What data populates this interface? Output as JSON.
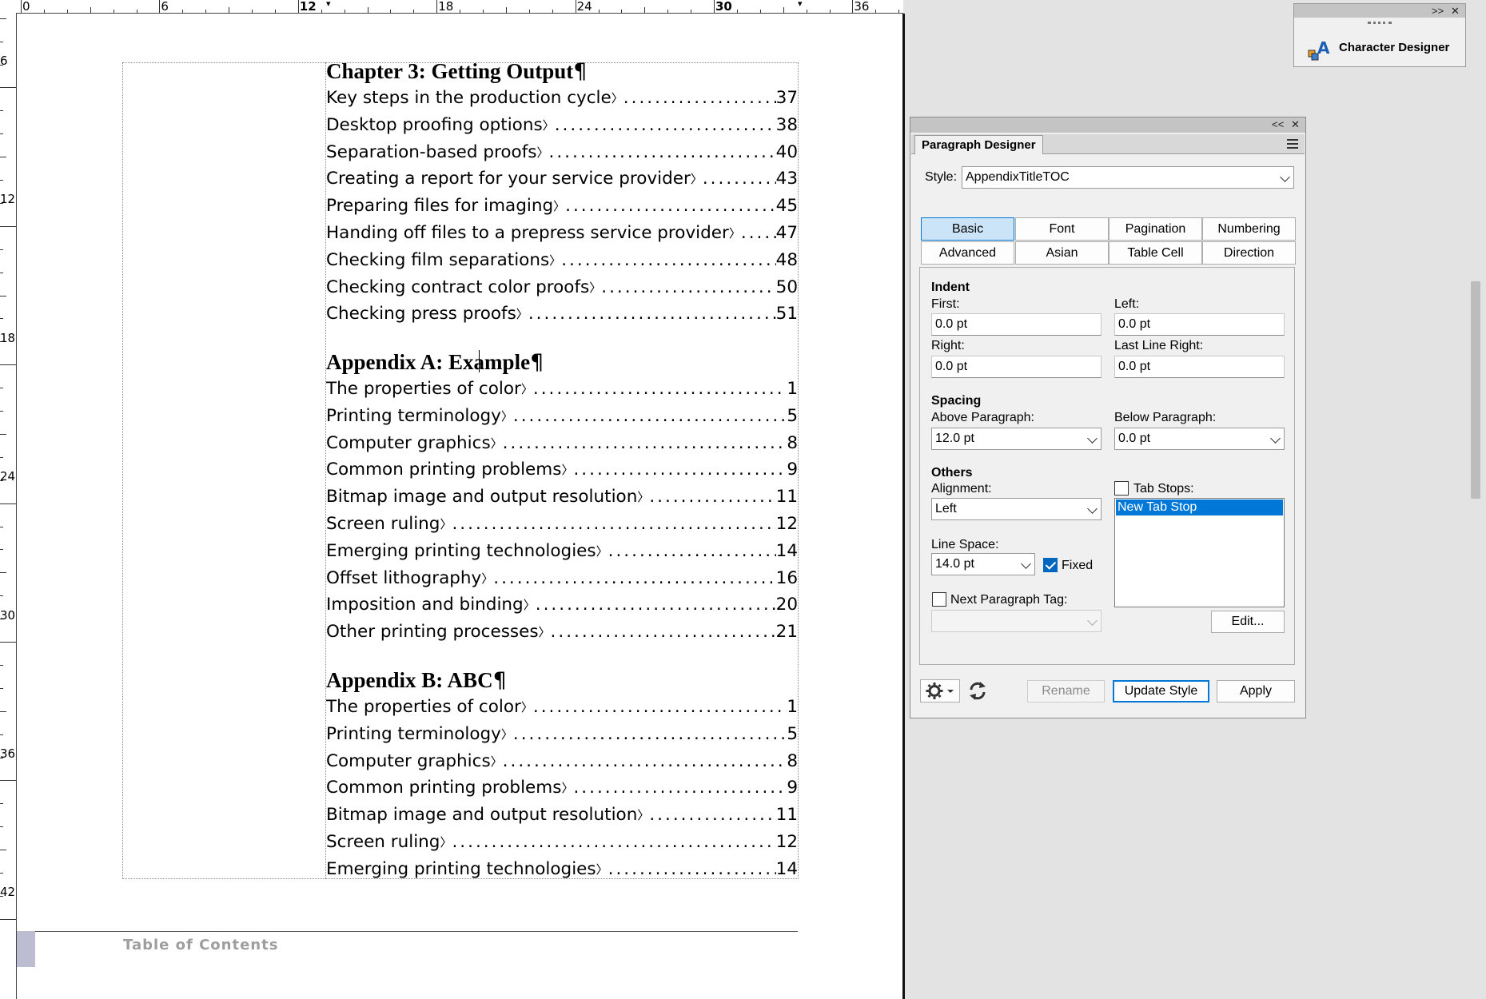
{
  "ruler": {
    "horizontal_labels": [
      "0",
      "6",
      "12",
      "18",
      "24",
      "30",
      "36"
    ],
    "vertical_labels": [
      "6",
      "12",
      "18",
      "24",
      "30",
      "36",
      "42"
    ]
  },
  "document": {
    "sections": [
      {
        "heading": "Chapter 3: Getting Output",
        "entries": [
          {
            "text": "Key steps in the production cycle",
            "page": "37"
          },
          {
            "text": "Desktop proofing options",
            "page": "38"
          },
          {
            "text": "Separation-based proofs",
            "page": "40"
          },
          {
            "text": "Creating a report for your service provider",
            "page": "43"
          },
          {
            "text": "Preparing files for imaging",
            "page": "45"
          },
          {
            "text": "Handing off files to a prepress service provider",
            "page": "47"
          },
          {
            "text": "Checking film separations",
            "page": "48"
          },
          {
            "text": "Checking contract color proofs",
            "page": "50"
          },
          {
            "text": "Checking press proofs",
            "page": "51"
          }
        ]
      },
      {
        "heading": "Appendix A: Example",
        "entries": [
          {
            "text": "The properties of color",
            "page": "1"
          },
          {
            "text": "Printing terminology",
            "page": "5"
          },
          {
            "text": "Computer graphics",
            "page": "8"
          },
          {
            "text": "Common printing problems",
            "page": "9"
          },
          {
            "text": "Bitmap image and output resolution",
            "page": "11"
          },
          {
            "text": "Screen ruling",
            "page": "12"
          },
          {
            "text": "Emerging printing technologies",
            "page": "14"
          },
          {
            "text": "Offset lithography",
            "page": "16"
          },
          {
            "text": "Imposition and binding",
            "page": "20"
          },
          {
            "text": "Other printing processes",
            "page": "21"
          }
        ]
      },
      {
        "heading": "Appendix B: ABC",
        "entries": [
          {
            "text": "The properties of color",
            "page": "1"
          },
          {
            "text": "Printing terminology",
            "page": "5"
          },
          {
            "text": "Computer graphics",
            "page": "8"
          },
          {
            "text": "Common printing problems",
            "page": "9"
          },
          {
            "text": "Bitmap image and output resolution",
            "page": "11"
          },
          {
            "text": "Screen ruling",
            "page": "12"
          },
          {
            "text": "Emerging printing technologies",
            "page": "14"
          }
        ]
      }
    ],
    "pilcrow": "¶",
    "entry_end_mark": "〉",
    "footer": "Table of Contents"
  },
  "character_designer": {
    "title": "Character Designer",
    "controls": ">>",
    "close": "✕"
  },
  "paragraph_designer": {
    "title": "Paragraph Designer",
    "controls": "<<",
    "close": "✕",
    "style_label": "Style:",
    "style_value": "AppendixTitleTOC",
    "tabs": [
      "Basic",
      "Font",
      "Pagination",
      "Numbering",
      "Advanced",
      "Asian",
      "Table Cell",
      "Direction"
    ],
    "active_tab": "Basic",
    "indent": {
      "heading": "Indent",
      "first_label": "First:",
      "first_value": "0.0 pt",
      "left_label": "Left:",
      "left_value": "0.0 pt",
      "right_label": "Right:",
      "right_value": "0.0 pt",
      "last_line_right_label": "Last Line Right:",
      "last_line_right_value": "0.0 pt"
    },
    "spacing": {
      "heading": "Spacing",
      "above_label": "Above Paragraph:",
      "above_value": "12.0 pt",
      "below_label": "Below Paragraph:",
      "below_value": "0.0 pt"
    },
    "others": {
      "heading": "Others",
      "alignment_label": "Alignment:",
      "alignment_value": "Left",
      "tab_stops_label": "Tab Stops:",
      "tab_stops_checked": false,
      "tab_stop_item": "New Tab Stop",
      "line_space_label": "Line Space:",
      "line_space_value": "14.0 pt",
      "fixed_label": "Fixed",
      "fixed_checked": true,
      "next_tag_label": "Next Paragraph Tag:",
      "next_tag_checked": false,
      "edit_label": "Edit..."
    },
    "buttons": {
      "rename": "Rename",
      "update_style": "Update Style",
      "apply": "Apply"
    }
  },
  "colors": {
    "accent": "#0078d7",
    "selection": "#0078d7",
    "footer_text": "#9e9e9e",
    "footer_tab": "#bdbdd2"
  }
}
